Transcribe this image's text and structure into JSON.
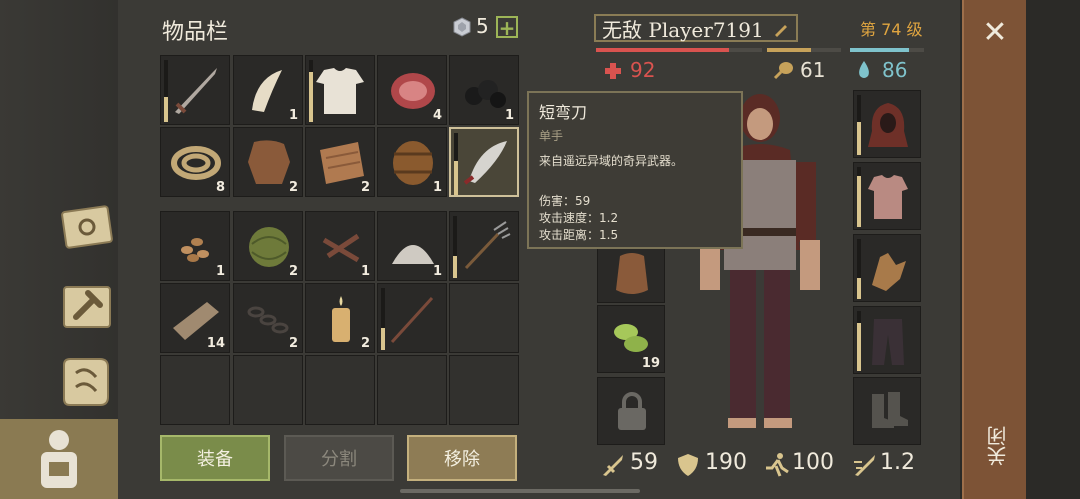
{
  "inventory": {
    "title": "物品栏",
    "gem_count": "5",
    "plus": "+",
    "slots": [
      {
        "icon": "sword-icon",
        "count": "",
        "dur": 0.4
      },
      {
        "icon": "tusk-icon",
        "count": "1"
      },
      {
        "icon": "shirt-icon",
        "count": "",
        "dur": 0.8
      },
      {
        "icon": "meat-icon",
        "count": "4"
      },
      {
        "icon": "coal-icon",
        "count": "1"
      },
      {
        "icon": "rope-icon",
        "count": "8"
      },
      {
        "icon": "leather-icon",
        "count": "2"
      },
      {
        "icon": "cloth-icon",
        "count": "2"
      },
      {
        "icon": "barrel-icon",
        "count": "1"
      },
      {
        "icon": "scimitar-icon",
        "count": "",
        "dur": 0.55
      },
      {
        "icon": "seeds-icon",
        "count": "1"
      },
      {
        "icon": "fiber-ball-icon",
        "count": "2"
      },
      {
        "icon": "nails-icon",
        "count": "1"
      },
      {
        "icon": "powder-icon",
        "count": "1"
      },
      {
        "icon": "pitchfork-icon",
        "count": "",
        "dur": 0.35
      },
      {
        "icon": "plank-icon",
        "count": "14"
      },
      {
        "icon": "chain-icon",
        "count": "2"
      },
      {
        "icon": "candle-icon",
        "count": "2"
      },
      {
        "icon": "spear-icon",
        "count": "",
        "dur": 0.35
      },
      {
        "icon": "",
        "count": ""
      }
    ]
  },
  "buttons": {
    "equip": "装备",
    "split": "分割",
    "remove": "移除"
  },
  "tooltip": {
    "name": "短弯刀",
    "type": "单手",
    "desc": "来自遥远异域的奇异武器。",
    "damage": "伤害：59",
    "speed": "攻击速度：1.2",
    "range": "攻击距离：1.5"
  },
  "player": {
    "name": "无敌 Player7191",
    "level": "第 74 级",
    "health": "92",
    "hunger": "61",
    "thirst": "86",
    "health_fill": 0.8,
    "hunger_fill": 0.6,
    "thirst_fill": 0.8,
    "bag_count": "19",
    "bottom": {
      "attack": "59",
      "defense": "190",
      "speed": "100",
      "attack_speed": "1.2"
    }
  },
  "close": {
    "x": "✕",
    "label": "关闭"
  },
  "colors": {
    "health": "#d9534f",
    "hunger": "#c7a25a",
    "thirst": "#7fc3cc",
    "accent": "#e0a540"
  }
}
